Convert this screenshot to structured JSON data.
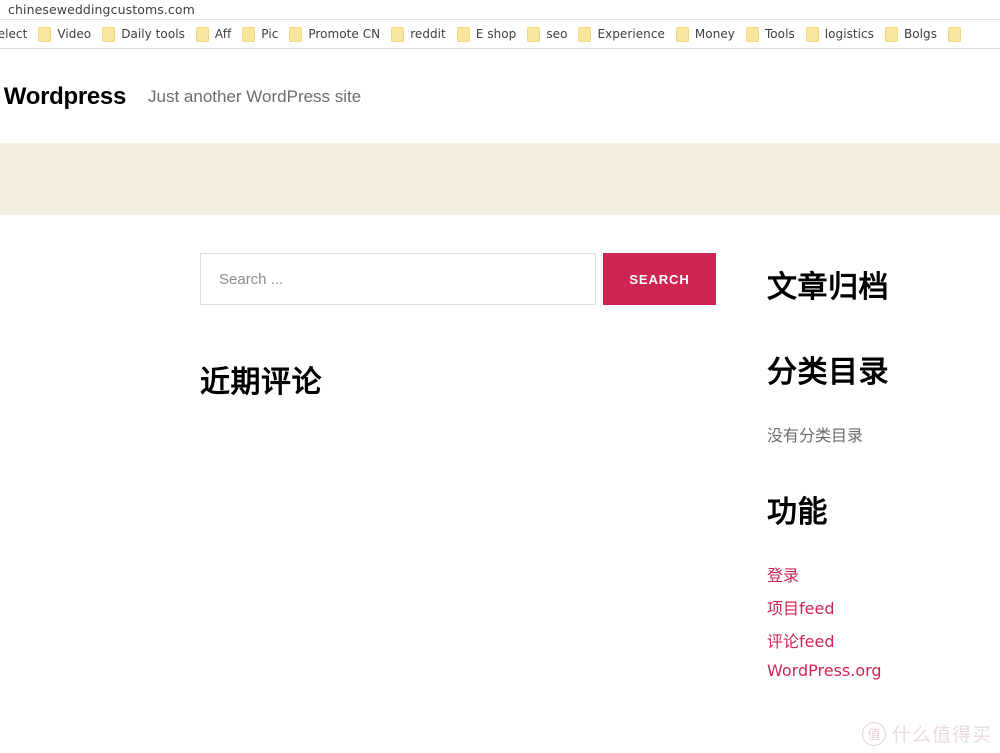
{
  "browser": {
    "omnibox": {
      "url": "chineseweddingcustoms.com"
    },
    "bookmarks": {
      "folder_icon_name": "bookmark-folder-icon",
      "items": [
        {
          "label": "Select"
        },
        {
          "label": "Video"
        },
        {
          "label": "Daily tools"
        },
        {
          "label": "Aff"
        },
        {
          "label": "Pic"
        },
        {
          "label": "Promote CN"
        },
        {
          "label": "reddit"
        },
        {
          "label": "E shop"
        },
        {
          "label": "seo"
        },
        {
          "label": "Experience"
        },
        {
          "label": "Money"
        },
        {
          "label": "Tools"
        },
        {
          "label": "logistics"
        },
        {
          "label": "Bolgs"
        },
        {
          "label": ""
        }
      ]
    }
  },
  "site": {
    "title": "ly Wordpress",
    "tagline": "Just another WordPress site",
    "banner_color": "#f5efe0",
    "accent_color": "#cd2653"
  },
  "search": {
    "placeholder": "Search ...",
    "value": "",
    "button_label": "SEARCH"
  },
  "widgets": {
    "recent_comments": {
      "heading": "近期评论"
    },
    "archives": {
      "heading": "文章归档"
    },
    "categories": {
      "heading": "分类目录",
      "empty_text": "没有分类目录"
    },
    "meta": {
      "heading": "功能",
      "links": [
        {
          "label": "登录"
        },
        {
          "label": "项目feed"
        },
        {
          "label": "评论feed"
        },
        {
          "label": "WordPress.org"
        }
      ]
    }
  },
  "watermark": {
    "badge": "值",
    "text": "什么值得买"
  }
}
